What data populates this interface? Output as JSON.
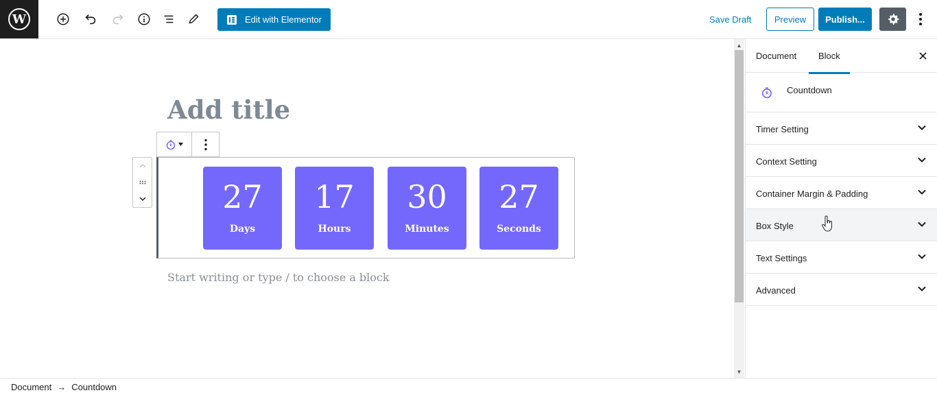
{
  "toolbar": {
    "logo_letter": "W",
    "elementor_label": "Edit with Elementor",
    "save_draft_label": "Save Draft",
    "preview_label": "Preview",
    "publish_label": "Publish..."
  },
  "editor": {
    "title_placeholder": "Add title",
    "appender_placeholder": "Start writing or type / to choose a block",
    "countdown": [
      {
        "value": "27",
        "label": "Days"
      },
      {
        "value": "17",
        "label": "Hours"
      },
      {
        "value": "30",
        "label": "Minutes"
      },
      {
        "value": "27",
        "label": "Seconds"
      }
    ],
    "box_color": "#7468fc"
  },
  "sidebar": {
    "tabs": [
      {
        "label": "Document"
      },
      {
        "label": "Block"
      }
    ],
    "block_name": "Countdown",
    "panels": [
      {
        "title": "Timer Setting"
      },
      {
        "title": "Context Setting"
      },
      {
        "title": "Container Margin & Padding"
      },
      {
        "title": "Box Style"
      },
      {
        "title": "Text Settings"
      },
      {
        "title": "Advanced"
      }
    ]
  },
  "breadcrumb": {
    "root": "Document",
    "separator": "→",
    "current": "Countdown"
  },
  "colors": {
    "accent": "#007cba",
    "dark": "#1e1e1e",
    "countdown": "#7468fc"
  }
}
